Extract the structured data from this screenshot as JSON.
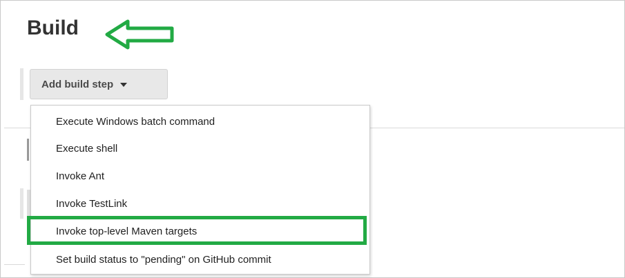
{
  "section": {
    "title": "Build"
  },
  "toolbar": {
    "add_step_label": "Add build step"
  },
  "menu": {
    "items": [
      "Execute Windows batch command",
      "Execute shell",
      "Invoke Ant",
      "Invoke TestLink",
      "Invoke top-level Maven targets",
      "Set build status to \"pending\" on GitHub commit"
    ],
    "highlighted_index": 4
  },
  "colors": {
    "annotation_green": "#22aa44",
    "title_text": "#333333",
    "button_bg": "#e8e8e8"
  },
  "icons": {
    "annotation": "arrow-left-icon",
    "dropdown": "chevron-down-icon"
  }
}
